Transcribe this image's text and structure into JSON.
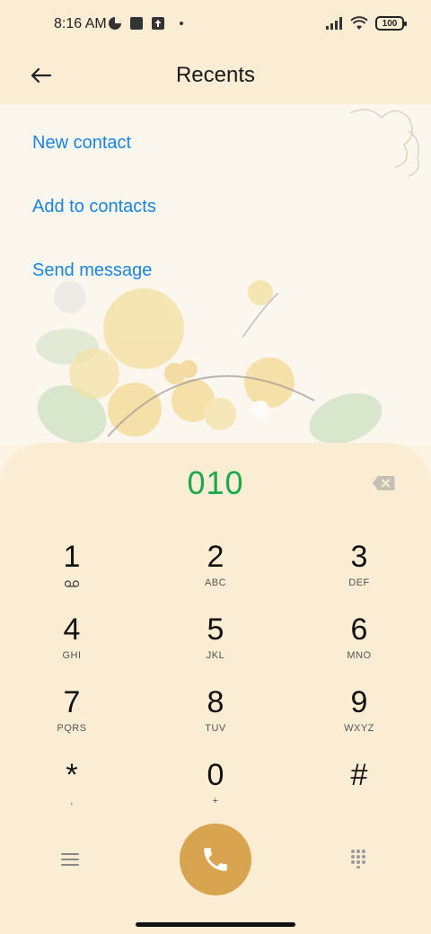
{
  "status_bar": {
    "time": "8:16 AM",
    "battery": "100",
    "icons": [
      "data-saver-icon",
      "square-icon",
      "upload-icon",
      "dot-icon",
      "signal-icon",
      "wifi-icon",
      "battery-icon"
    ]
  },
  "header": {
    "title": "Recents",
    "back_icon": "arrow-left-icon"
  },
  "menu": {
    "new_contact": "New contact",
    "add_to_contacts": "Add to contacts",
    "send_message": "Send message"
  },
  "dialer": {
    "number": "010",
    "keys": [
      {
        "digit": "1",
        "letters": ""
      },
      {
        "digit": "2",
        "letters": "ABC"
      },
      {
        "digit": "3",
        "letters": "DEF"
      },
      {
        "digit": "4",
        "letters": "GHI"
      },
      {
        "digit": "5",
        "letters": "JKL"
      },
      {
        "digit": "6",
        "letters": "MNO"
      },
      {
        "digit": "7",
        "letters": "PQRS"
      },
      {
        "digit": "8",
        "letters": "TUV"
      },
      {
        "digit": "9",
        "letters": "WXYZ"
      },
      {
        "digit": "*",
        "letters": ","
      },
      {
        "digit": "0",
        "letters": "+"
      },
      {
        "digit": "#",
        "letters": ""
      }
    ]
  },
  "colors": {
    "accent_link": "#1a84e0",
    "number_green": "#1aaa4a",
    "call_button": "#d9a44f",
    "panel": "#fbecd4"
  }
}
